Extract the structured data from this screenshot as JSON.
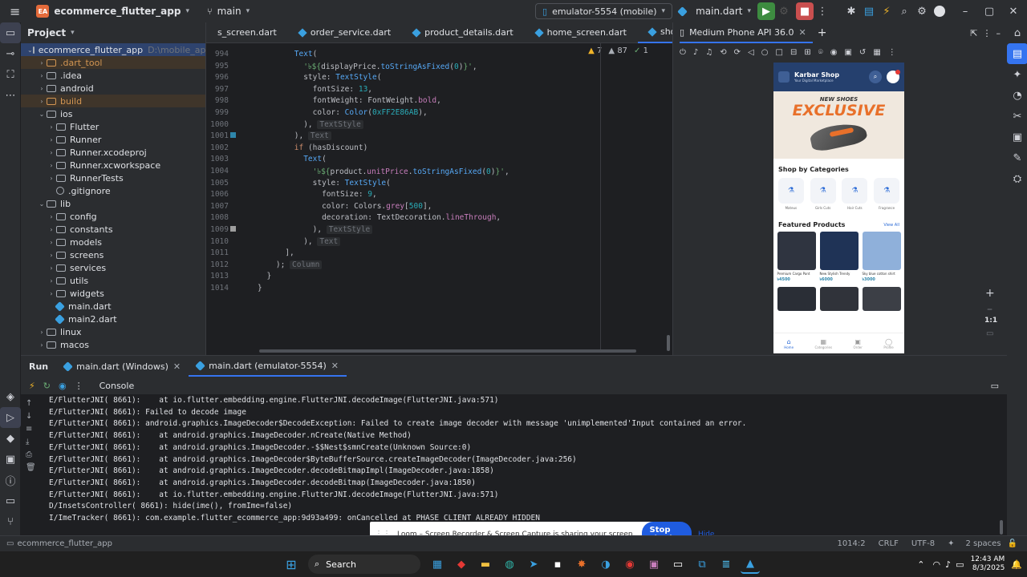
{
  "titlebar": {
    "project_badge": "EA",
    "project_name": "ecommerce_flutter_app",
    "branch": "main",
    "device": "emulator-5554 (mobile)",
    "run_config": "main.dart"
  },
  "project_panel": {
    "title": "Project",
    "root": "ecommerce_flutter_app",
    "root_path": "D:\\mobile_app_flutter",
    "items": [
      {
        "label": ".dart_tool",
        "level": 1,
        "type": "folder",
        "style": "orange",
        "expand": "›"
      },
      {
        "label": ".idea",
        "level": 1,
        "type": "folder",
        "style": "",
        "expand": "›"
      },
      {
        "label": "android",
        "level": 1,
        "type": "folder",
        "style": "",
        "expand": "›"
      },
      {
        "label": "build",
        "level": 1,
        "type": "folder",
        "style": "orange",
        "expand": "›"
      },
      {
        "label": "ios",
        "level": 1,
        "type": "folder",
        "style": "",
        "expand": "⌄"
      },
      {
        "label": "Flutter",
        "level": 2,
        "type": "folder",
        "style": "",
        "expand": "›"
      },
      {
        "label": "Runner",
        "level": 2,
        "type": "folder",
        "style": "",
        "expand": "›"
      },
      {
        "label": "Runner.xcodeproj",
        "level": 2,
        "type": "folder",
        "style": "",
        "expand": "›"
      },
      {
        "label": "Runner.xcworkspace",
        "level": 2,
        "type": "folder",
        "style": "",
        "expand": "›"
      },
      {
        "label": "RunnerTests",
        "level": 2,
        "type": "folder",
        "style": "",
        "expand": "›"
      },
      {
        "label": ".gitignore",
        "level": 2,
        "type": "gitignore",
        "style": "",
        "expand": ""
      },
      {
        "label": "lib",
        "level": 1,
        "type": "folder",
        "style": "",
        "expand": "⌄"
      },
      {
        "label": "config",
        "level": 2,
        "type": "folder",
        "style": "",
        "expand": "›"
      },
      {
        "label": "constants",
        "level": 2,
        "type": "folder",
        "style": "",
        "expand": "›"
      },
      {
        "label": "models",
        "level": 2,
        "type": "folder",
        "style": "",
        "expand": "›"
      },
      {
        "label": "screens",
        "level": 2,
        "type": "folder",
        "style": "",
        "expand": "›"
      },
      {
        "label": "services",
        "level": 2,
        "type": "folder",
        "style": "",
        "expand": "›"
      },
      {
        "label": "utils",
        "level": 2,
        "type": "folder",
        "style": "",
        "expand": "›"
      },
      {
        "label": "widgets",
        "level": 2,
        "type": "folder",
        "style": "",
        "expand": "›"
      },
      {
        "label": "main.dart",
        "level": 2,
        "type": "dart",
        "style": "",
        "expand": ""
      },
      {
        "label": "main2.dart",
        "level": 2,
        "type": "dart",
        "style": "",
        "expand": ""
      },
      {
        "label": "linux",
        "level": 1,
        "type": "folder",
        "style": "",
        "expand": "›"
      },
      {
        "label": "macos",
        "level": 1,
        "type": "folder",
        "style": "",
        "expand": "›"
      }
    ]
  },
  "editor": {
    "tabs": [
      "s_screen.dart",
      "order_service.dart",
      "product_details.dart",
      "home_screen.dart",
      "shop_screen.dart"
    ],
    "active_tab": "shop_screen.dart",
    "inspections": {
      "warnings": "7",
      "weak": "87",
      "typos": "1"
    },
    "lines": [
      {
        "n": "994",
        "html": "        <span class='cls'>Text</span>("
      },
      {
        "n": "995",
        "html": "          <span class='str'>'৳${</span>displayPrice.<span class='cls'>toStringAsFixed</span>(<span class='num'>0</span>)<span class='str'>}'</span>,"
      },
      {
        "n": "996",
        "html": "          style: <span class='cls'>TextStyle</span>("
      },
      {
        "n": "997",
        "html": "            fontSize: <span class='num'>13</span>,"
      },
      {
        "n": "998",
        "html": "            fontWeight: FontWeight.<span class='prop'>bold</span>,"
      },
      {
        "n": "999",
        "html": "            color: <span class='cls'>Color</span>(<span class='num'>0xFF2E86AB</span>),"
      },
      {
        "n": "1000",
        "html": "          ), <span class='hint'>TextStyle</span>"
      },
      {
        "n": "1001",
        "html": "        ), <span class='hint'>Text</span>"
      },
      {
        "n": "1002",
        "html": "        <span class='kw'>if</span> (hasDiscount)"
      },
      {
        "n": "1003",
        "html": "          <span class='cls'>Text</span>("
      },
      {
        "n": "1004",
        "html": "            <span class='str'>'৳${</span>product.<span class='prop'>unitPrice</span>.<span class='cls'>toStringAsFixed</span>(<span class='num'>0</span>)<span class='str'>}'</span>,"
      },
      {
        "n": "1005",
        "html": "            style: <span class='cls'>TextStyle</span>("
      },
      {
        "n": "1006",
        "html": "              fontSize: <span class='num'>9</span>,"
      },
      {
        "n": "1007",
        "html": "              color: Colors.<span class='prop'>grey</span>[<span class='num'>500</span>],"
      },
      {
        "n": "1008",
        "html": "              decoration: TextDecoration.<span class='prop'>lineThrough</span>,"
      },
      {
        "n": "1009",
        "html": "            ), <span class='hint'>TextStyle</span>"
      },
      {
        "n": "1010",
        "html": "          ), <span class='hint'>Text</span>"
      },
      {
        "n": "1011",
        "html": "      ],"
      },
      {
        "n": "1012",
        "html": "    ); <span class='hint'>Column</span>"
      },
      {
        "n": "1013",
        "html": "  }"
      },
      {
        "n": "1014",
        "html": "}"
      }
    ]
  },
  "emulator": {
    "title": "Medium Phone API 36.0",
    "zoom": "1:1",
    "app": {
      "shop_name": "Karbar Shop",
      "subtitle": "Your Digital Marketplace",
      "banner_top": "NEW SHOES",
      "banner_main": "EXCLUSIVE",
      "categories_title": "Shop by Categories",
      "categories": [
        "Mateus",
        "Girls Cuts",
        "Hair Cuts",
        "Fragrance"
      ],
      "featured_title": "Featured Products",
      "view_all": "View All",
      "products": [
        {
          "name": "Premium Cargo Pant",
          "price": "৳4500",
          "color": "#2f3440"
        },
        {
          "name": "New Stylish Trendy",
          "price": "৳6000",
          "color": "#1f3356"
        },
        {
          "name": "Sky blue cotton shirt",
          "price": "৳3000",
          "color": "#8fb0da"
        }
      ],
      "nav": [
        "Home",
        "Categories",
        "Order",
        "Profile"
      ]
    }
  },
  "run_panel": {
    "tab_label": "Run",
    "sessions": [
      "main.dart (Windows)",
      "main.dart (emulator-5554)"
    ],
    "console_label": "Console",
    "log_lines": [
      "E/FlutterJNI( 8661):    at io.flutter.embedding.engine.FlutterJNI.decodeImage(FlutterJNI.java:571)",
      "E/FlutterJNI( 8661): Failed to decode image",
      "E/FlutterJNI( 8661): android.graphics.ImageDecoder$DecodeException: Failed to create image decoder with message 'unimplemented'Input contained an error.",
      "E/FlutterJNI( 8661):    at android.graphics.ImageDecoder.nCreate(Native Method)",
      "E/FlutterJNI( 8661):    at android.graphics.ImageDecoder.-$$Nest$smnCreate(Unknown Source:0)",
      "E/FlutterJNI( 8661):    at android.graphics.ImageDecoder$ByteBufferSource.createImageDecoder(ImageDecoder.java:256)",
      "E/FlutterJNI( 8661):    at android.graphics.ImageDecoder.decodeBitmapImpl(ImageDecoder.java:1858)",
      "E/FlutterJNI( 8661):    at android.graphics.ImageDecoder.decodeBitmap(ImageDecoder.java:1850)",
      "E/FlutterJNI( 8661):    at io.flutter.embedding.engine.FlutterJNI.decodeImage(FlutterJNI.java:571)",
      "D/InsetsController( 8661): hide(ime(), fromIme=false)",
      "I/ImeTracker( 8661): com.example.flutter_ecommerce_app:9d93a499: onCancelled at PHASE_CLIENT_ALREADY_HIDDEN"
    ]
  },
  "loom": {
    "message": "Loom – Screen Recorder & Screen Capture is sharing your screen.",
    "stop_label": "Stop sharing",
    "hide_label": "Hide"
  },
  "statusbar": {
    "project": "ecommerce_flutter_app",
    "position": "1014:2",
    "line_sep": "CRLF",
    "encoding": "UTF-8",
    "indent": "2 spaces"
  },
  "taskbar": {
    "search": "Search",
    "time": "12:43 AM",
    "date": "8/3/2025"
  }
}
